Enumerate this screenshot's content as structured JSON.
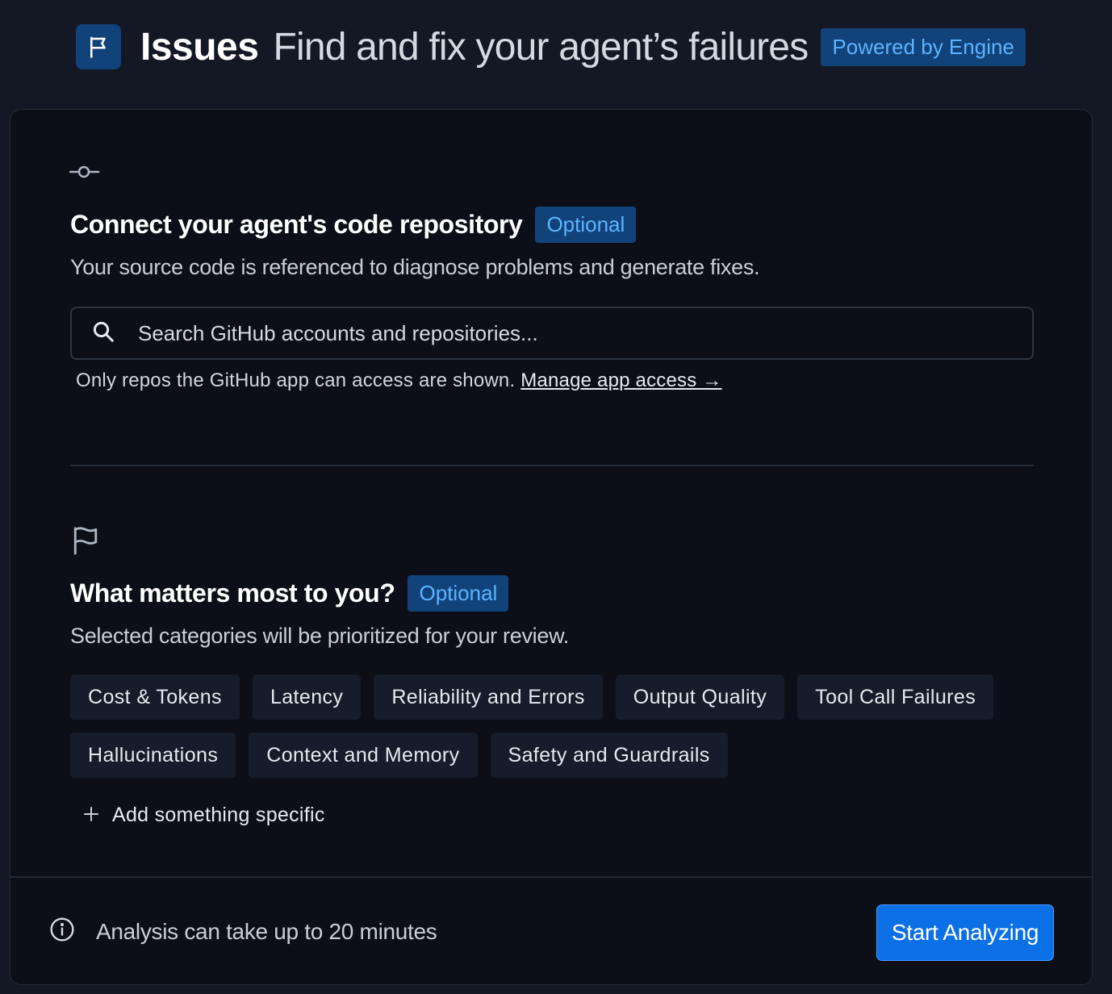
{
  "header": {
    "title": "Issues",
    "subtitle": "Find and fix your agent’s failures",
    "powered_badge": "Powered by Engine",
    "icon": "flag-icon"
  },
  "repo_section": {
    "icon": "git-commit-icon",
    "title": "Connect your agent's code repository",
    "optional_badge": "Optional",
    "description": "Your source code is referenced to diagnose problems and generate fixes.",
    "search": {
      "icon": "search-icon",
      "placeholder": "Search GitHub accounts and repositories...",
      "value": ""
    },
    "access_note": "Only repos the GitHub app can access are shown.",
    "access_link": "Manage app access →"
  },
  "priorities_section": {
    "icon": "flag-icon",
    "title": "What matters most to you?",
    "optional_badge": "Optional",
    "description": "Selected categories will be prioritized for your review.",
    "categories": [
      "Cost & Tokens",
      "Latency",
      "Reliability and Errors",
      "Output Quality",
      "Tool Call Failures",
      "Hallucinations",
      "Context and Memory",
      "Safety and Guardrails"
    ],
    "add_label": "Add something specific"
  },
  "footer": {
    "info_icon": "info-icon",
    "info_text": "Analysis can take up to 20 minutes",
    "start_button": "Start Analyzing"
  },
  "colors": {
    "page_bg": "#131824",
    "card_bg": "#0c0f18",
    "badge_bg": "#12427a",
    "badge_text": "#5cb4ff",
    "chip_bg": "#161c29",
    "primary_button": "#0b6fe6"
  }
}
